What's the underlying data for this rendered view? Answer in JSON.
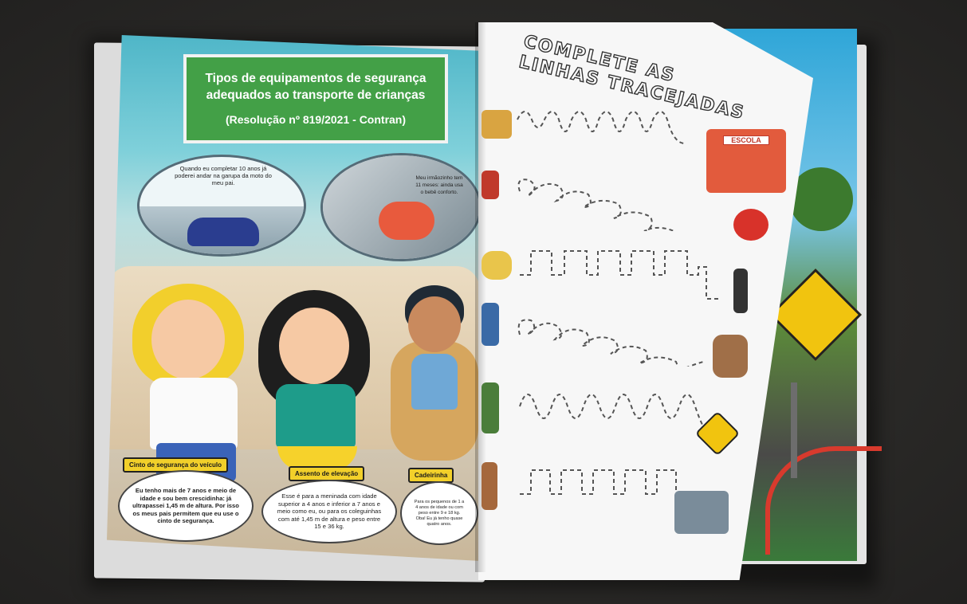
{
  "left_page": {
    "title_line1": "Tipos de equipamentos de segurança",
    "title_line2": "adequados ao transporte de crianças",
    "title_resolution": "(Resolução nº 819/2021 - Contran)",
    "bubble_moto_text": "Quando eu completar 10 anos já poderei andar na garupa da moto do meu pai.",
    "bubble_baby_text": "Meu irmãozinho tem 11 meses: ainda usa o bebê conforto.",
    "labels": {
      "cinto": "Cinto de segurança do veículo",
      "assento": "Assento de elevação",
      "cadeirinha": "Cadeirinha"
    },
    "speech": {
      "cinto": "Eu tenho mais de 7 anos e meio de idade e sou bem crescidinha: já ultrapassei 1,45 m de altura. Por isso os meus pais permitem que eu use o cinto de segurança.",
      "assento": "Esse é para a meninada com idade superior a 4 anos e inferior a 7 anos e meio como eu, ou para os coleguinhas com até 1,45 m de altura e peso entre 15 e 36 kg.",
      "cadeirinha": "Para os pequenos de 1 a 4 anos de idade ou com peso entre 9 e 18 kg. Oba! Eu já tenho quase quatro anos."
    }
  },
  "right_page": {
    "title_line1": "COMPLETE AS",
    "title_line2": "LINHAS TRACEJADAS",
    "school_sign": "ESCOLA",
    "rows": [
      {
        "left_icon": "bus-icon",
        "right_icon": "school-icon",
        "pattern": "loops-tall"
      },
      {
        "left_icon": "motorcycle-icon",
        "right_icon": "helmet-icon",
        "pattern": "loops"
      },
      {
        "left_icon": "car-icon",
        "right_icon": "traffic-light-icon",
        "pattern": "square"
      },
      {
        "left_icon": "boy-icon",
        "right_icon": "car-seat-icon",
        "pattern": "loops"
      },
      {
        "left_icon": "cyclist-icon",
        "right_icon": "bike-sign-icon",
        "pattern": "waves"
      },
      {
        "left_icon": "child-icon",
        "right_icon": "crosswalk-icon",
        "pattern": "square"
      }
    ]
  },
  "colors": {
    "title_green": "#43a047",
    "label_yellow": "#f2d02a",
    "sign_yellow": "#f1c40f"
  }
}
